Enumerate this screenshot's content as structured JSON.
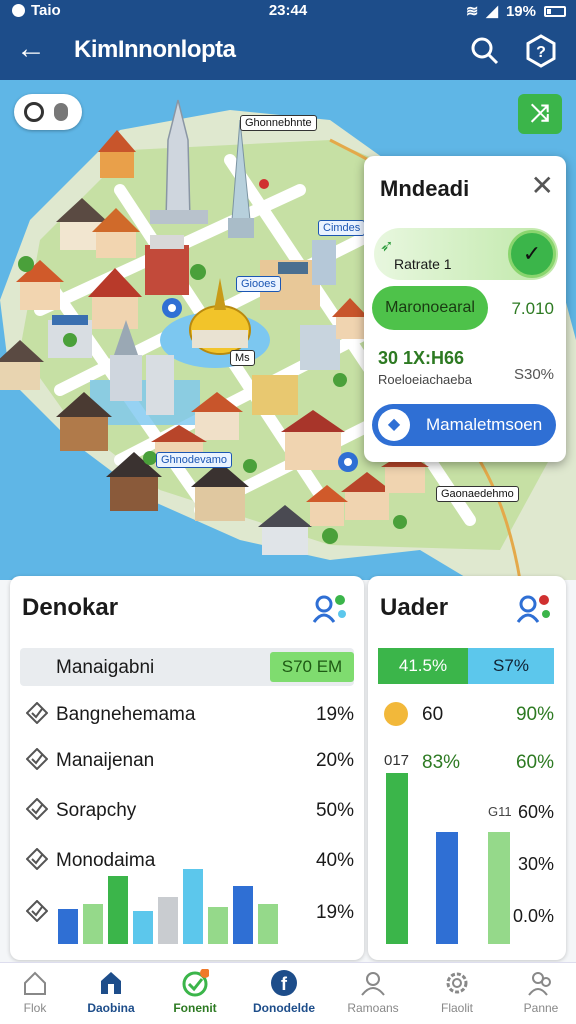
{
  "status_bar": {
    "carrier": "Taio",
    "time": "23:44",
    "battery": "19%"
  },
  "header": {
    "title": "KimInnonlopta"
  },
  "map": {
    "labels": [
      "Ghonnebhnte",
      "Cimdes",
      "Giooes",
      "Ms",
      "Ghnodevamo",
      "Gaonaedehmo"
    ]
  },
  "popup": {
    "title": "Mndeadi",
    "progress_label": "Ratrate 1",
    "pill_label": "Maronoearal",
    "pill_value": "7.010",
    "stat_value": "30 1X:H66",
    "stat_sub": "Roeloeiachaeba",
    "stat_percent": "S30%",
    "action_label": "Mamaletmsoen"
  },
  "left_panel": {
    "title": "Denokar",
    "header_row": {
      "label": "Manaigabni",
      "value": "S70 EM"
    },
    "rows": [
      {
        "label": "Bangnehemama",
        "value": "19%"
      },
      {
        "label": "Manaijenan",
        "value": "20%"
      },
      {
        "label": "Sorapchy",
        "value": "50%"
      },
      {
        "label": "Monodaima",
        "value": "40%"
      },
      {
        "label": "",
        "value": "19%"
      }
    ],
    "bars": [
      {
        "value": 35,
        "color": "#2f6fd4"
      },
      {
        "value": 40,
        "color": "#95d98a"
      },
      {
        "value": 68,
        "color": "#3bb54a"
      },
      {
        "value": 33,
        "color": "#5cc7ec"
      },
      {
        "value": 47,
        "color": "#c9ccd0"
      },
      {
        "value": 75,
        "color": "#5cc7ec"
      },
      {
        "value": 37,
        "color": "#95d98a"
      },
      {
        "value": 58,
        "color": "#2f6fd4"
      },
      {
        "value": 40,
        "color": "#95d98a"
      }
    ]
  },
  "right_panel": {
    "title": "Uader",
    "header": {
      "left": "41.5%",
      "right": "S7%"
    },
    "row1": {
      "value": "60",
      "percent": "90%"
    },
    "row2": {
      "left": "017",
      "mid": "83%",
      "percent": "60%"
    },
    "scale": [
      "60%",
      "30%",
      "0.0%"
    ],
    "small_label": "G11",
    "bars": [
      {
        "value": 95,
        "color": "#3bb54a"
      },
      {
        "value": 62,
        "color": "#2f6fd4"
      },
      {
        "value": 62,
        "color": "#95d98a"
      }
    ]
  },
  "bottom_nav": [
    {
      "label": "Flok",
      "icon": "home-icon"
    },
    {
      "label": "Daobina",
      "icon": "store-icon"
    },
    {
      "label": "Fonenit",
      "icon": "check-badge-icon"
    },
    {
      "label": "Donodelde",
      "icon": "facebook-icon"
    },
    {
      "label": "Ramoans",
      "icon": "person-icon"
    },
    {
      "label": "Flaolit",
      "icon": "gear-icon"
    },
    {
      "label": "Panne",
      "icon": "people-icon"
    }
  ]
}
